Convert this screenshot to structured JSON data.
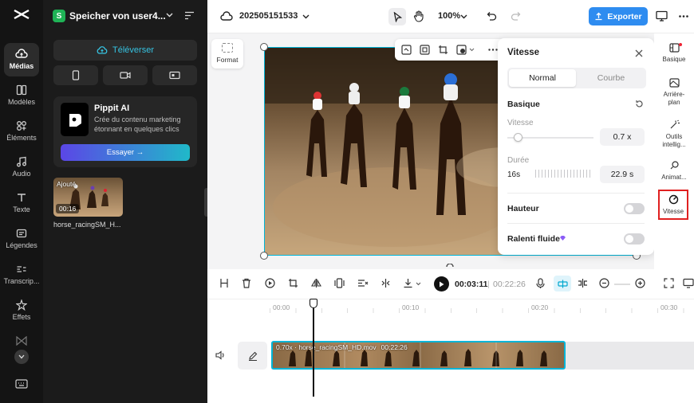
{
  "rail": {
    "items": [
      {
        "label": "Médias",
        "icon": "cloud-icon"
      },
      {
        "label": "Modèles",
        "icon": "templates-icon"
      },
      {
        "label": "Éléments",
        "icon": "elements-icon"
      },
      {
        "label": "Audio",
        "icon": "music-icon"
      },
      {
        "label": "Texte",
        "icon": "text-icon"
      },
      {
        "label": "Légendes",
        "icon": "captions-icon"
      },
      {
        "label": "Transcrip...",
        "icon": "transcript-icon"
      },
      {
        "label": "Effets",
        "icon": "effects-icon"
      }
    ]
  },
  "panel": {
    "workspace_badge": "S",
    "title": "Speicher von user4...",
    "upload_label": "Téléverser",
    "promo": {
      "title": "Pippit AI",
      "description": "Crée du contenu marketing étonnant en quelques clics",
      "button": "Essayer →"
    },
    "media": [
      {
        "badge": "Ajouté",
        "duration": "00:16",
        "name": "horse_racingSM_H..."
      }
    ]
  },
  "topbar": {
    "project_name": "202505151533",
    "zoom": "100%",
    "export_label": "Exporter"
  },
  "stage": {
    "format_label": "Format"
  },
  "speed_panel": {
    "title": "Vitesse",
    "tabs": [
      "Normal",
      "Courbe"
    ],
    "active_tab": "Normal",
    "section_basic": "Basique",
    "speed_label": "Vitesse",
    "speed_value": "0.7 x",
    "duration_label": "Durée",
    "duration_original": "16s",
    "duration_value": "22.9 s",
    "pitch_label": "Hauteur",
    "pitch_on": false,
    "smooth_label": "Ralenti fluide",
    "smooth_on": false
  },
  "rightbar": {
    "items": [
      {
        "label": "Basique",
        "icon": "basic-icon"
      },
      {
        "label": "Arrière-plan",
        "icon": "background-icon"
      },
      {
        "label": "Outils intellig...",
        "icon": "magic-icon"
      },
      {
        "label": "Animat...",
        "icon": "animation-icon"
      },
      {
        "label": "Vitesse",
        "icon": "speed-icon"
      }
    ]
  },
  "toolbar": {
    "current_time": "00:03:11",
    "total_time": "00:22:26"
  },
  "timeline": {
    "ticks": [
      "00:00",
      "00:10",
      "00:20",
      "00:30"
    ],
    "clip_label": "0.70x · horse_racingSM_HD.mov",
    "clip_duration": "00:22:26"
  },
  "colors": {
    "accent": "#00b5d8",
    "export_button": "#2e8cf0",
    "highlight_box": "#e02020"
  }
}
